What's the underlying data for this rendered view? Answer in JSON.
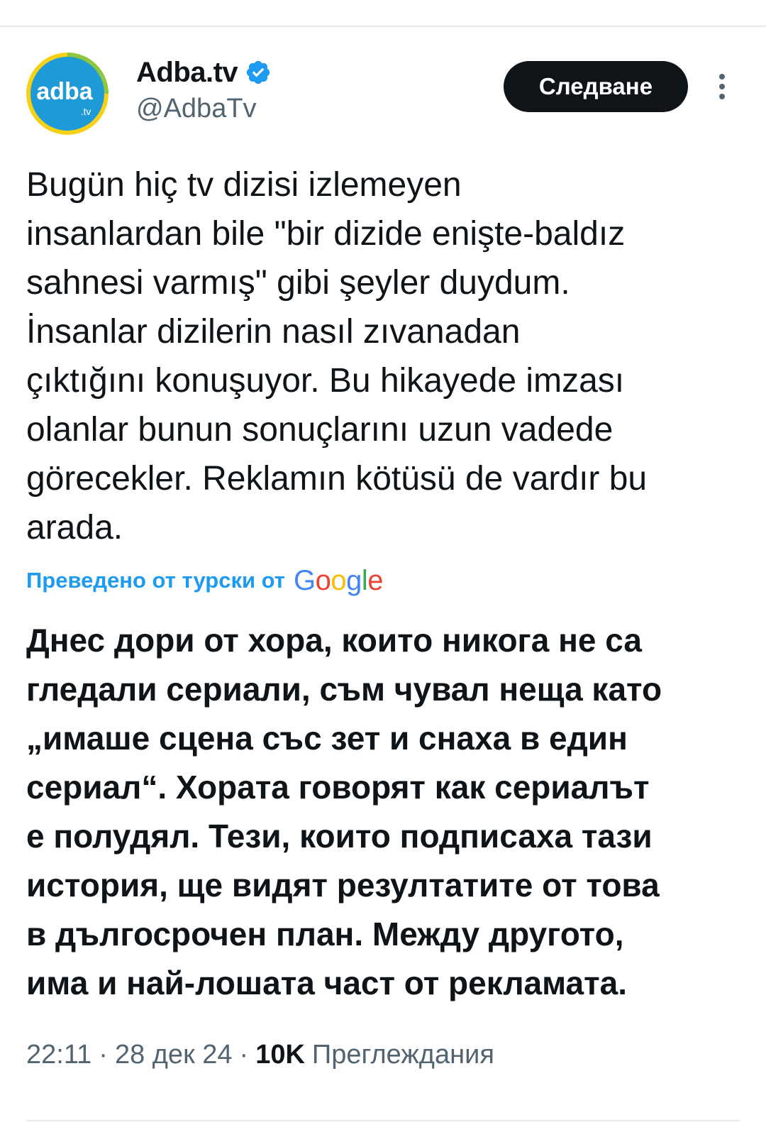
{
  "author": {
    "display_name": "Adba.tv",
    "handle": "@AdbaTv",
    "avatar_text": "adba",
    "avatar_subtext": ".tv",
    "verified_icon": "verified-badge-icon"
  },
  "header": {
    "follow_label": "Следване",
    "more_icon": "more-vertical-icon"
  },
  "tweet": {
    "text_lines": [
      "Bugün hiç tv dizisi izlemeyen",
      "insanlardan bile \"bir dizide enişte-baldız",
      "sahnesi varmış\" gibi şeyler duydum.",
      "İnsanlar dizilerin nasıl zıvanadan",
      "çıktığını konuşuyor. Bu hikayede imzası",
      "olanlar bunun sonuçlarını uzun vadede",
      "görecekler. Reklamın kötüsü de vardır bu",
      "arada."
    ]
  },
  "translation": {
    "label": "Преведено от турски от",
    "provider_letters": [
      "G",
      "o",
      "o",
      "g",
      "l",
      "e"
    ],
    "text_lines": [
      "Днес дори от хора, които никога не са",
      "гледали сериали, съм чувал неща като",
      "„имаше сцена със зет и снаха в един",
      "сериал“. Хората говорят как сериалът",
      "е полудял. Тези, които подписаха тази",
      "история, ще видят резултатите от това",
      "в дългосрочен план. Между другото,",
      "има и най-лошата част от рекламата."
    ]
  },
  "meta": {
    "time": "22:11",
    "separator": "·",
    "date": "28 дек 24",
    "views_count": "10K",
    "views_label": "Преглеждания"
  },
  "colors": {
    "link_blue": "#1d9bf0",
    "text_primary": "#0f1419",
    "text_secondary": "#536471",
    "divider": "#e7e9ea",
    "avatar_blue": "#1e9ad6",
    "avatar_green": "#8dc63f",
    "avatar_yellow": "#f7d117"
  }
}
